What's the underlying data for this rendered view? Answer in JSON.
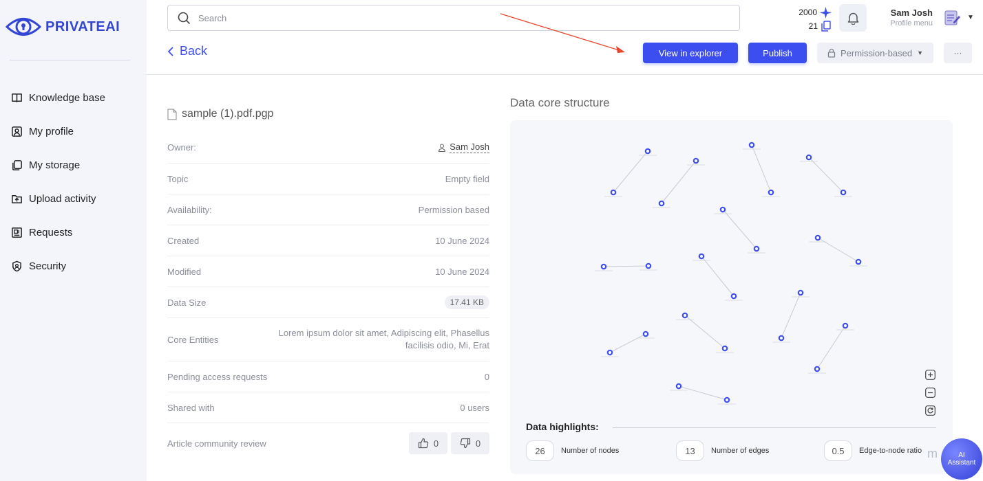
{
  "brand": {
    "name": "PRIVATEAI",
    "accent": "#3346d3"
  },
  "sidebar": {
    "items": [
      {
        "label": "Knowledge base",
        "icon": "book-icon"
      },
      {
        "label": "My profile",
        "icon": "profile-icon"
      },
      {
        "label": "My storage",
        "icon": "storage-icon"
      },
      {
        "label": "Upload activity",
        "icon": "upload-icon"
      },
      {
        "label": "Requests",
        "icon": "requests-icon"
      },
      {
        "label": "Security",
        "icon": "shield-icon"
      }
    ]
  },
  "header": {
    "search_placeholder": "Search",
    "credits": "2000",
    "files": "21",
    "user_name": "Sam Josh",
    "user_sub": "Profile menu"
  },
  "toolbar": {
    "back": "Back",
    "view_explorer": "View in explorer",
    "publish": "Publish",
    "permission": "Permission-based",
    "more": "···"
  },
  "file": {
    "title": "sample (1).pdf.pgp",
    "rows": [
      {
        "label": "Owner:",
        "value": "Sam Josh"
      },
      {
        "label": "Topic",
        "value": "Empty field"
      },
      {
        "label": "Availability:",
        "value": "Permission based"
      },
      {
        "label": "Created",
        "value": "10 June 2024"
      },
      {
        "label": "Modified",
        "value": "10 June 2024"
      },
      {
        "label": "Data Size",
        "value": "17.41 KB"
      },
      {
        "label": "Core Entities",
        "value": "Lorem ipsum dolor sit amet, Adipiscing elit, Phasellus facilisis odio, Mi, Erat"
      },
      {
        "label": "Pending access requests",
        "value": "0"
      },
      {
        "label": "Shared with",
        "value": "0 users"
      },
      {
        "label": "Article community review",
        "likes": "0",
        "dislikes": "0"
      }
    ]
  },
  "graph": {
    "title": "Data core structure",
    "node_color": "#3d4ef0",
    "highlights_title": "Data highlights:",
    "highlights": [
      {
        "value": "26",
        "label": "Number of nodes"
      },
      {
        "value": "13",
        "label": "Number of edges"
      },
      {
        "value": "0.5",
        "label": "Edge-to-node ratio"
      }
    ]
  },
  "assistant": {
    "line1": "AI",
    "line2": "Assistant",
    "mark": "m"
  }
}
